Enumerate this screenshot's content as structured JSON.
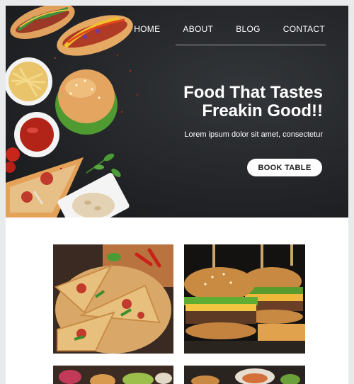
{
  "nav": {
    "items": [
      {
        "label": "HOME"
      },
      {
        "label": "ABOUT"
      },
      {
        "label": "BLOG"
      },
      {
        "label": "CONTACT"
      }
    ]
  },
  "hero": {
    "headline_line1": "Food That Tastes",
    "headline_line2": "Freakin Good!!",
    "subtext": "Lorem ipsum dolor sit amet, consectetur",
    "cta_label": "BOOK TABLE"
  },
  "gallery": {
    "items": [
      {
        "icon": "pizza-photo"
      },
      {
        "icon": "burger-photo"
      },
      {
        "icon": "food-photo"
      },
      {
        "icon": "food-photo"
      }
    ]
  },
  "colors": {
    "hero_bg": "#232528",
    "button_bg": "#ffffff",
    "button_text": "#1a1a1a",
    "page_bg": "#e9eaec"
  }
}
